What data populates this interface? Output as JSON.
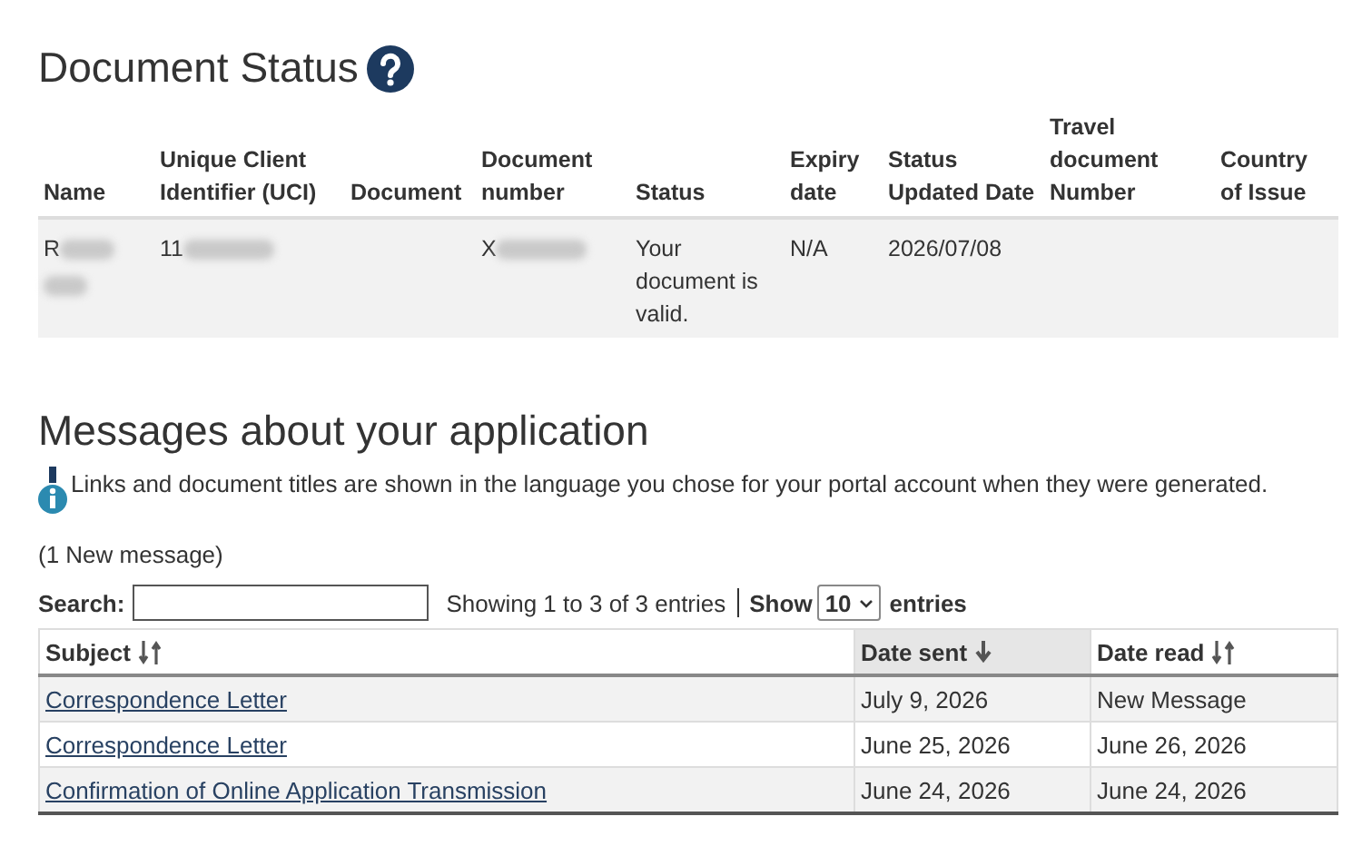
{
  "document_status": {
    "title": "Document Status",
    "columns": [
      "Name",
      "Unique Client Identifier (UCI)",
      "Document",
      "Document number",
      "Status",
      "Expiry date",
      "Status Updated Date",
      "Travel document Number",
      "Country of Issue"
    ],
    "rows": [
      {
        "name": {
          "text": "R",
          "redacted": true
        },
        "uci": {
          "text": "11",
          "redacted": true
        },
        "document_number": {
          "text": "X",
          "redacted": true
        },
        "status": "Your document is valid.",
        "expiry_date": "N/A",
        "status_updated_date": "2026/07/08"
      }
    ]
  },
  "messages": {
    "title": "Messages about your application",
    "info": "Links and document titles are shown in the language you chose for your portal account when they were generated.",
    "new_count": "(1 New message)",
    "search_label": "Search:",
    "showing": "Showing 1 to 3 of 3 entries",
    "show_label": "Show",
    "page_size": "10",
    "entries_label": "entries",
    "columns": [
      {
        "label": "Subject",
        "selected": false
      },
      {
        "label": "Date sent",
        "selected": true
      },
      {
        "label": "Date read",
        "selected": false
      }
    ],
    "rows": [
      {
        "subject": "Correspondence Letter",
        "date_sent": "July 9, 2026",
        "date_read": "New Message"
      },
      {
        "subject": "Correspondence Letter",
        "date_sent": "June 25, 2026",
        "date_read": "June 26, 2026"
      },
      {
        "subject": "Confirmation of Online Application Transmission",
        "date_sent": "June 24, 2026",
        "date_read": "June 24, 2026"
      }
    ]
  }
}
